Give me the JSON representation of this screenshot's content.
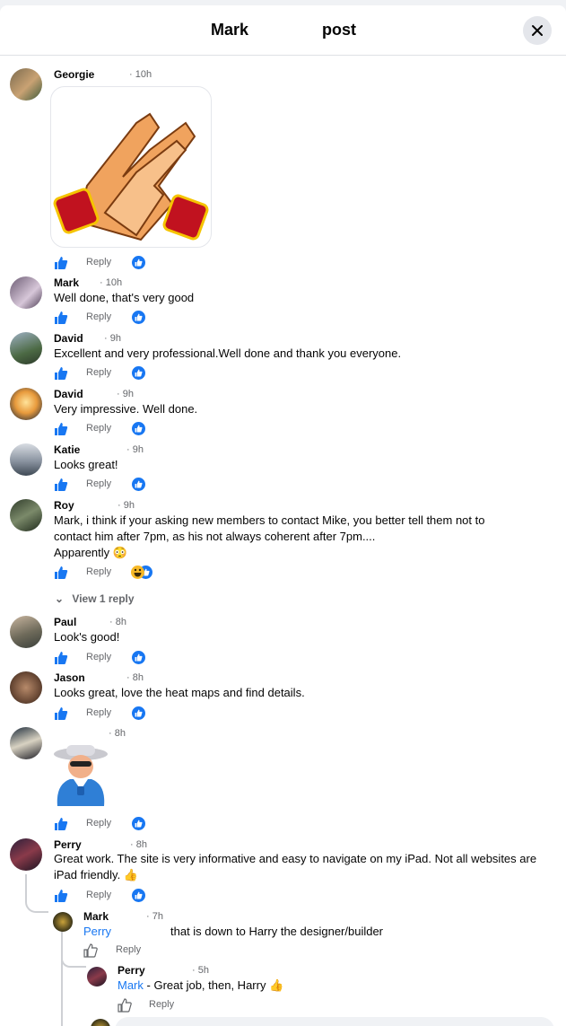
{
  "header": {
    "author": "Mark",
    "suffix": "post"
  },
  "labels": {
    "reply": "Reply",
    "view_replies": "View 1 reply",
    "like": "like-icon"
  },
  "comments": [
    {
      "name": "Georgie",
      "time": "· 10h",
      "text": ""
    },
    {
      "name": "Mark",
      "time": "· 10h",
      "text": "Well done, that's very good"
    },
    {
      "name": "David",
      "time": "· 9h",
      "text": "Excellent and very professional.Well done and thank you everyone."
    },
    {
      "name": "David",
      "time": "· 9h",
      "text": "Very impressive. Well done."
    },
    {
      "name": "Katie",
      "time": "· 9h",
      "text": "Looks great!"
    },
    {
      "name": "Roy",
      "time": "· 9h",
      "text": "Mark, i think if your asking new members to contact Mike, you better tell them not to contact him after 7pm, as his not always coherent after 7pm....",
      "text2": "Apparently 😳"
    },
    {
      "name": "Paul",
      "time": "· 8h",
      "text": "Look's good!"
    },
    {
      "name": "Jason",
      "time": "· 8h",
      "text": "Looks great, love the heat maps and find details."
    },
    {
      "name": "",
      "time": "· 8h",
      "text": ""
    },
    {
      "name": "Perry",
      "time": "· 8h",
      "text": "Great work. The site is very informative and easy to navigate on my iPad. Not all websites are iPad friendly. 👍"
    }
  ],
  "replies": [
    {
      "name": "Mark",
      "time": "· 7h",
      "mention": "Perry",
      "text": "that is down to Harry the designer/builder"
    },
    {
      "name": "Perry",
      "time": "· 5h",
      "mention": "Mark",
      "text": "- Great job, then, Harry 👍"
    }
  ],
  "colors": {
    "accent": "#1877f2",
    "meta": "#65676b",
    "haha": "#f7b928"
  }
}
